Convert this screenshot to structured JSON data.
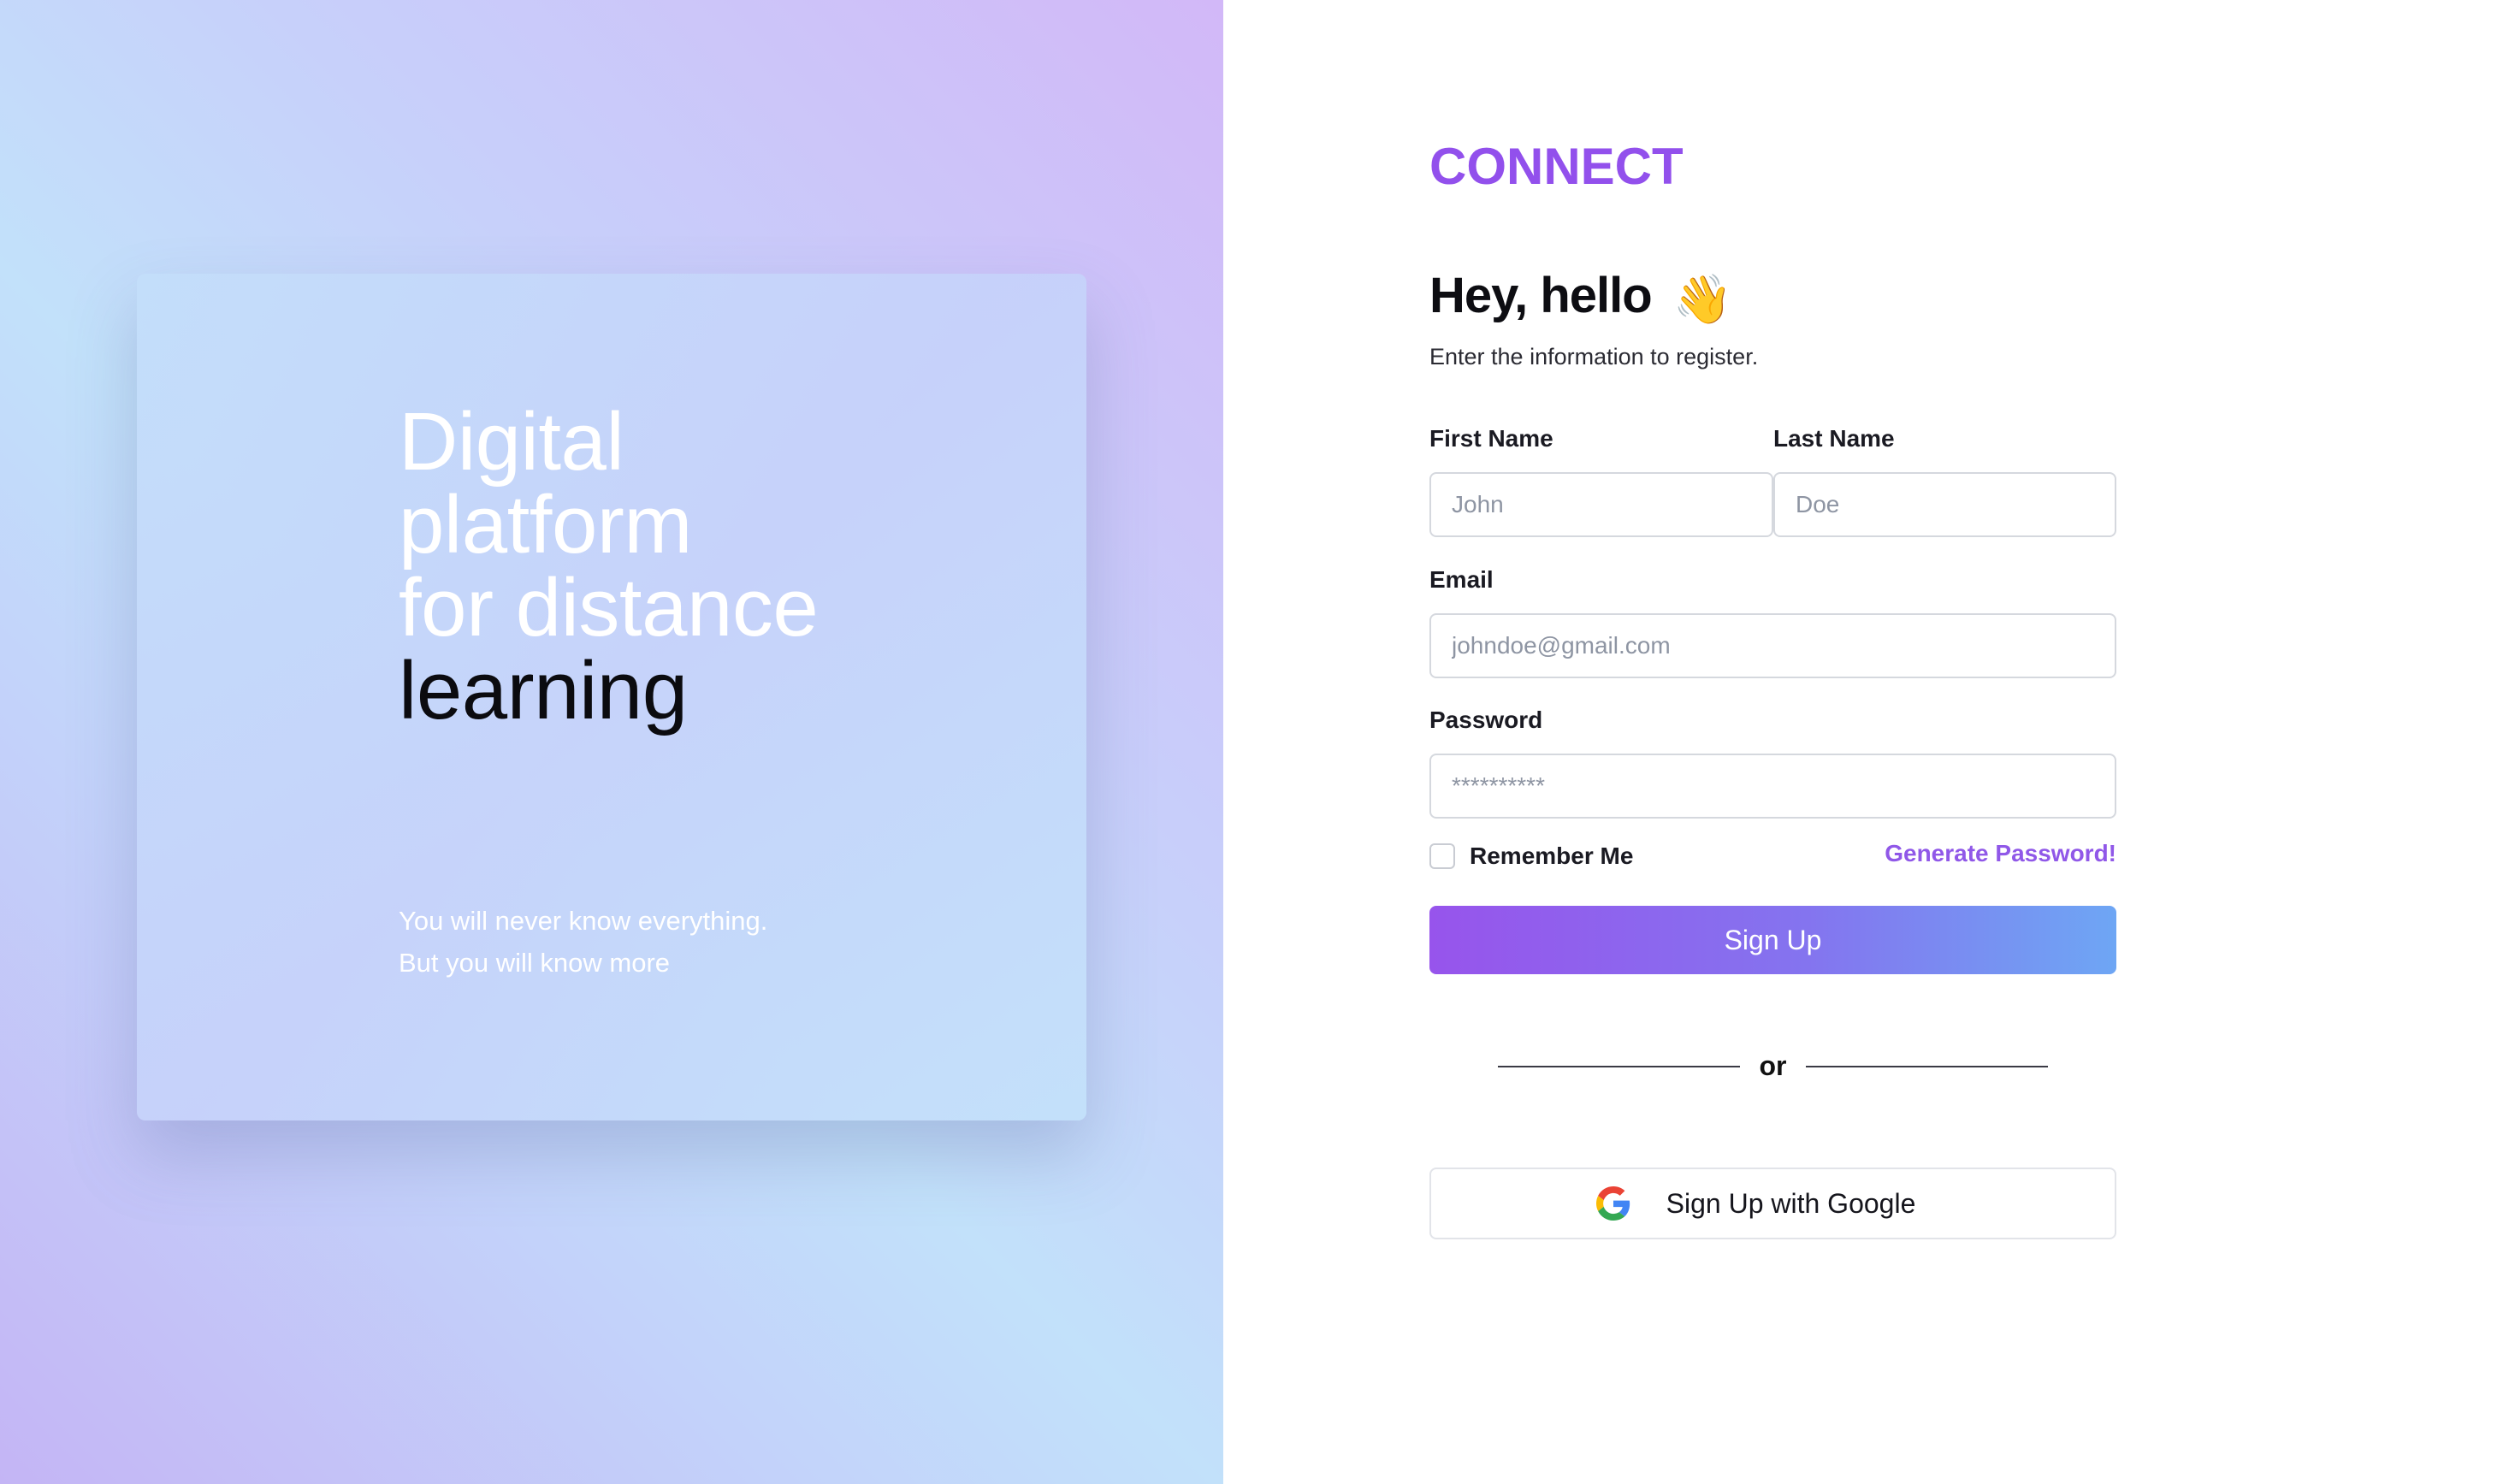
{
  "hero": {
    "headline_lines": [
      "Digital",
      "platform",
      "for distance",
      "learning"
    ],
    "quote_lines": [
      "You will never know everything.",
      "But you will know more"
    ]
  },
  "form": {
    "brand": "CONNECT",
    "greeting": "Hey, hello",
    "greeting_emoji": "👋",
    "subtitle": "Enter the information to register.",
    "first_name": {
      "label": "First Name",
      "placeholder": "John",
      "value": ""
    },
    "last_name": {
      "label": "Last Name",
      "placeholder": "Doe",
      "value": ""
    },
    "email": {
      "label": "Email",
      "placeholder": "johndoe@gmail.com",
      "value": ""
    },
    "password": {
      "label": "Password",
      "placeholder": "**********",
      "value": ""
    },
    "remember_me": {
      "label": "Remember Me",
      "checked": false
    },
    "generate_password_label": "Generate Password!",
    "signup_label": "Sign Up",
    "divider_text": "or",
    "google_label": "Sign Up with Google",
    "google_icon": "google-icon"
  },
  "colors": {
    "brand": "#9250ec",
    "link": "#9058e8",
    "button_gradient_start": "#9754ec",
    "button_gradient_end": "#6ea6f4"
  }
}
